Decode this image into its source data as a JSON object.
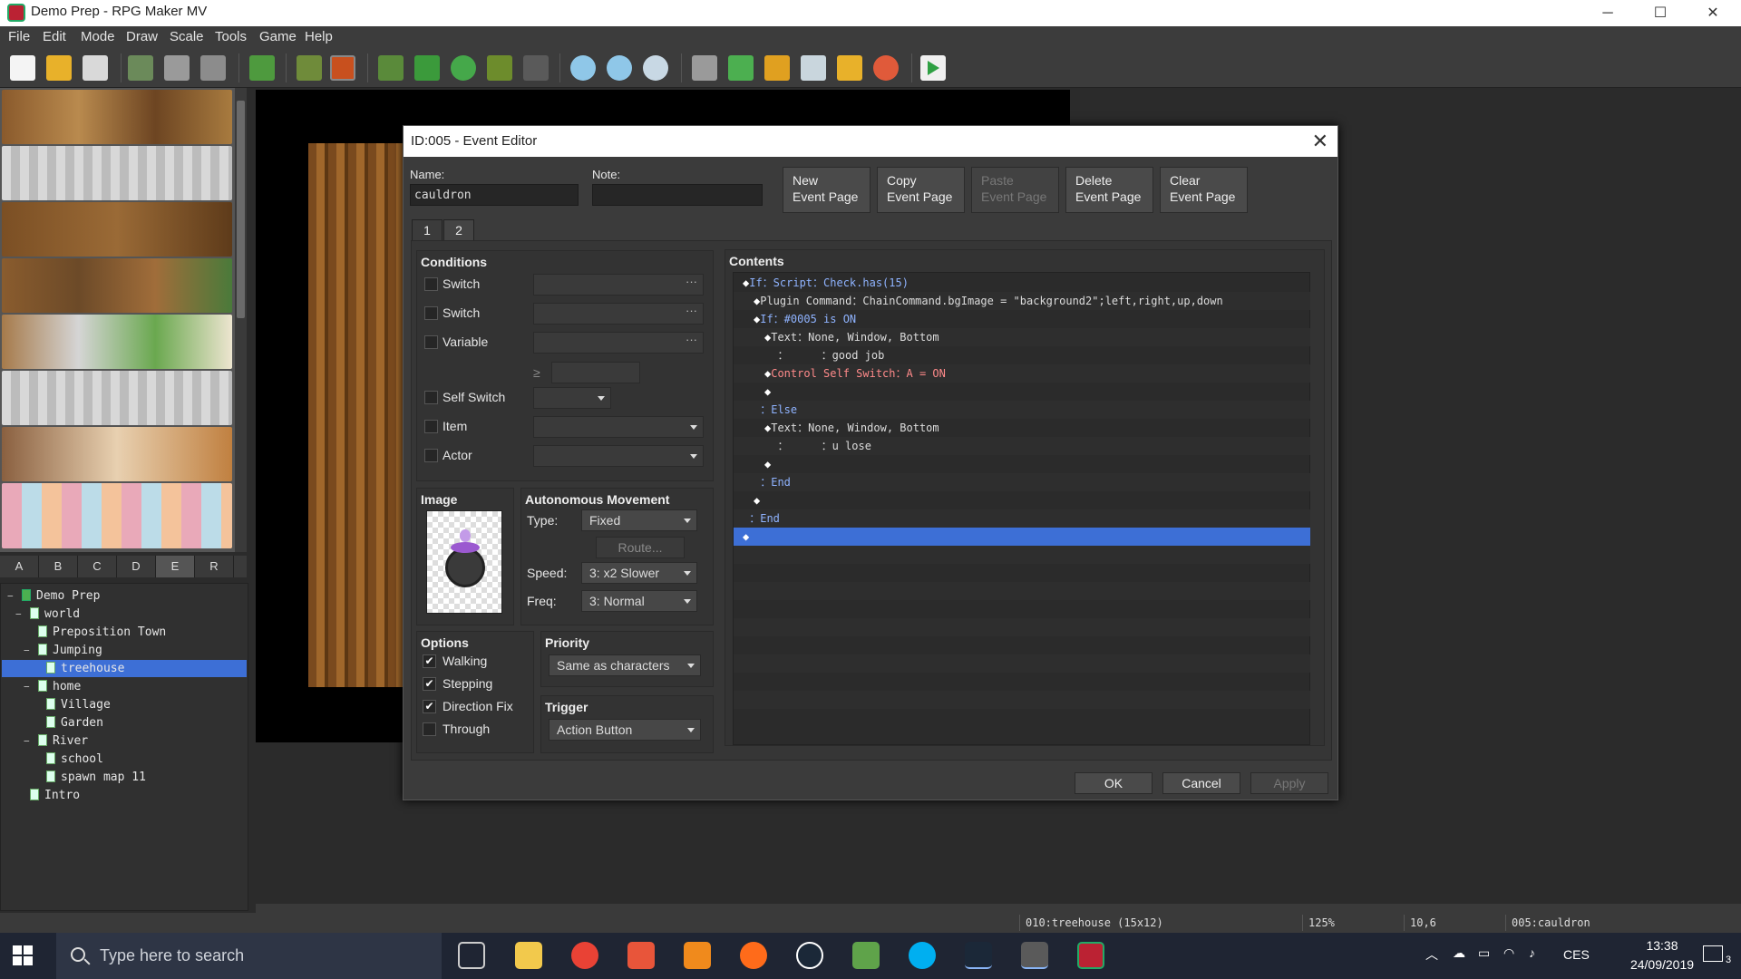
{
  "window": {
    "title": "Demo Prep - RPG Maker MV"
  },
  "menu": [
    "File",
    "Edit",
    "Mode",
    "Draw",
    "Scale",
    "Tools",
    "Game",
    "Help"
  ],
  "tileset_tabs": [
    "A",
    "B",
    "C",
    "D",
    "E",
    "R"
  ],
  "map_tree": [
    {
      "label": "Demo Prep",
      "level": 0,
      "expander": "−"
    },
    {
      "label": "world",
      "level": 1,
      "expander": "−"
    },
    {
      "label": "Preposition Town",
      "level": 2,
      "expander": ""
    },
    {
      "label": "Jumping",
      "level": 2,
      "expander": "−"
    },
    {
      "label": "treehouse",
      "level": 3,
      "expander": "",
      "selected": true
    },
    {
      "label": "home",
      "level": 2,
      "expander": "−"
    },
    {
      "label": "Village",
      "level": 3,
      "expander": ""
    },
    {
      "label": "Garden",
      "level": 3,
      "expander": ""
    },
    {
      "label": "River",
      "level": 2,
      "expander": "−"
    },
    {
      "label": "school",
      "level": 3,
      "expander": ""
    },
    {
      "label": "spawn map 11",
      "level": 3,
      "expander": ""
    },
    {
      "label": "Intro",
      "level": 1,
      "expander": ""
    }
  ],
  "status": {
    "map": "010:treehouse (15x12)",
    "zoom": "125%",
    "coords": "10,6",
    "event": "005:cauldron"
  },
  "taskbar": {
    "search_placeholder": "Type here to search",
    "lang": "CES",
    "time": "13:38",
    "date": "24/09/2019",
    "notif": "3"
  },
  "dialog": {
    "title": "ID:005 - Event Editor",
    "name_label": "Name:",
    "name_value": "cauldron",
    "note_label": "Note:",
    "note_value": "",
    "page_buttons": [
      {
        "l1": "New",
        "l2": "Event Page",
        "enabled": true
      },
      {
        "l1": "Copy",
        "l2": "Event Page",
        "enabled": true
      },
      {
        "l1": "Paste",
        "l2": "Event Page",
        "enabled": false
      },
      {
        "l1": "Delete",
        "l2": "Event Page",
        "enabled": true
      },
      {
        "l1": "Clear",
        "l2": "Event Page",
        "enabled": true
      }
    ],
    "tabs": [
      "1",
      "2"
    ],
    "conditions": {
      "title": "Conditions",
      "switch1": "Switch",
      "switch2": "Switch",
      "variable": "Variable",
      "gte": "≥",
      "self_switch": "Self Switch",
      "item": "Item",
      "actor": "Actor"
    },
    "image": {
      "title": "Image"
    },
    "autonomous": {
      "title": "Autonomous Movement",
      "type_label": "Type:",
      "type_value": "Fixed",
      "route": "Route...",
      "speed_label": "Speed:",
      "speed_value": "3: x2 Slower",
      "freq_label": "Freq:",
      "freq_value": "3: Normal"
    },
    "options": {
      "title": "Options",
      "walking": "Walking",
      "stepping": "Stepping",
      "direction_fix": "Direction Fix",
      "through": "Through"
    },
    "options_checked": {
      "walking": true,
      "stepping": true,
      "direction_fix": true,
      "through": false
    },
    "priority": {
      "title": "Priority",
      "value": "Same as characters"
    },
    "trigger": {
      "title": "Trigger",
      "value": "Action Button"
    },
    "contents": {
      "title": "Contents",
      "lines": [
        {
          "indent": 0,
          "parts": [
            [
              "◆",
              "dm"
            ],
            [
              "If：Script：Check.has(15)",
              "kw"
            ]
          ]
        },
        {
          "indent": 1,
          "parts": [
            [
              "◆",
              "dm"
            ],
            [
              "Plugin Command：ChainCommand.bgImage = \"background2\";left,right,up,down",
              ""
            ]
          ]
        },
        {
          "indent": 1,
          "parts": [
            [
              "◆",
              "dm"
            ],
            [
              "If：#0005 is ON",
              "kw"
            ]
          ]
        },
        {
          "indent": 2,
          "parts": [
            [
              "◆",
              "dm"
            ],
            [
              "Text：None, Window, Bottom",
              ""
            ]
          ]
        },
        {
          "indent": 2,
          "parts": [
            [
              "  ：     ：good job",
              ""
            ]
          ]
        },
        {
          "indent": 2,
          "parts": [
            [
              "◆",
              "dm"
            ],
            [
              "Control Self Switch：A = ON",
              "rd"
            ]
          ]
        },
        {
          "indent": 2,
          "parts": [
            [
              "◆",
              "dm"
            ]
          ]
        },
        {
          "indent": 1,
          "parts": [
            [
              " ：Else",
              "kw"
            ]
          ]
        },
        {
          "indent": 2,
          "parts": [
            [
              "◆",
              "dm"
            ],
            [
              "Text：None, Window, Bottom",
              ""
            ]
          ]
        },
        {
          "indent": 2,
          "parts": [
            [
              "  ：     ：u lose",
              ""
            ]
          ]
        },
        {
          "indent": 2,
          "parts": [
            [
              "◆",
              "dm"
            ]
          ]
        },
        {
          "indent": 1,
          "parts": [
            [
              " ：End",
              "kw"
            ]
          ]
        },
        {
          "indent": 1,
          "parts": [
            [
              "◆",
              "dm"
            ]
          ]
        },
        {
          "indent": 0,
          "parts": [
            [
              " ：End",
              "kw"
            ]
          ]
        },
        {
          "indent": 0,
          "parts": [
            [
              "◆",
              "dm"
            ]
          ],
          "selected": true
        }
      ]
    },
    "buttons": {
      "ok": "OK",
      "cancel": "Cancel",
      "apply": "Apply"
    }
  }
}
